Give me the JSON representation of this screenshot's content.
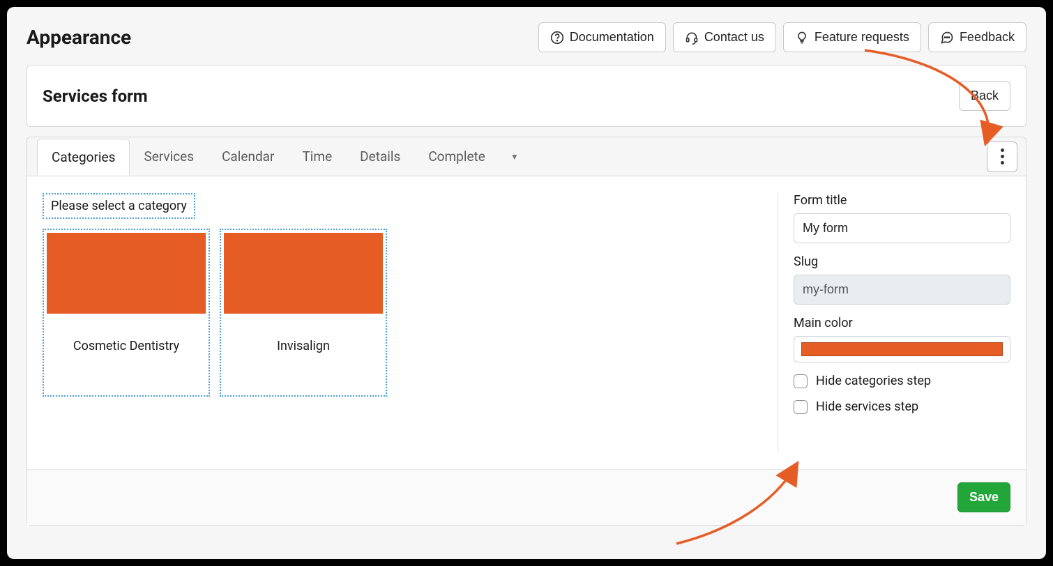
{
  "header": {
    "title": "Appearance",
    "buttons": {
      "documentation": "Documentation",
      "contact": "Contact us",
      "feature": "Feature requests",
      "feedback": "Feedback"
    }
  },
  "panel": {
    "title": "Services form",
    "back": "Back"
  },
  "tabs": [
    {
      "label": "Categories",
      "active": true
    },
    {
      "label": "Services",
      "active": false
    },
    {
      "label": "Calendar",
      "active": false
    },
    {
      "label": "Time",
      "active": false
    },
    {
      "label": "Details",
      "active": false
    },
    {
      "label": "Complete",
      "active": false
    }
  ],
  "categories": {
    "hint": "Please select a category",
    "items": [
      {
        "label": "Cosmetic Dentistry"
      },
      {
        "label": "Invisalign"
      }
    ]
  },
  "form": {
    "title_label": "Form title",
    "title_value": "My form",
    "slug_label": "Slug",
    "slug_value": "my-form",
    "color_label": "Main color",
    "color_value": "#e65c25",
    "hide_categories": "Hide categories step",
    "hide_services": "Hide services step"
  },
  "footer": {
    "save": "Save"
  }
}
